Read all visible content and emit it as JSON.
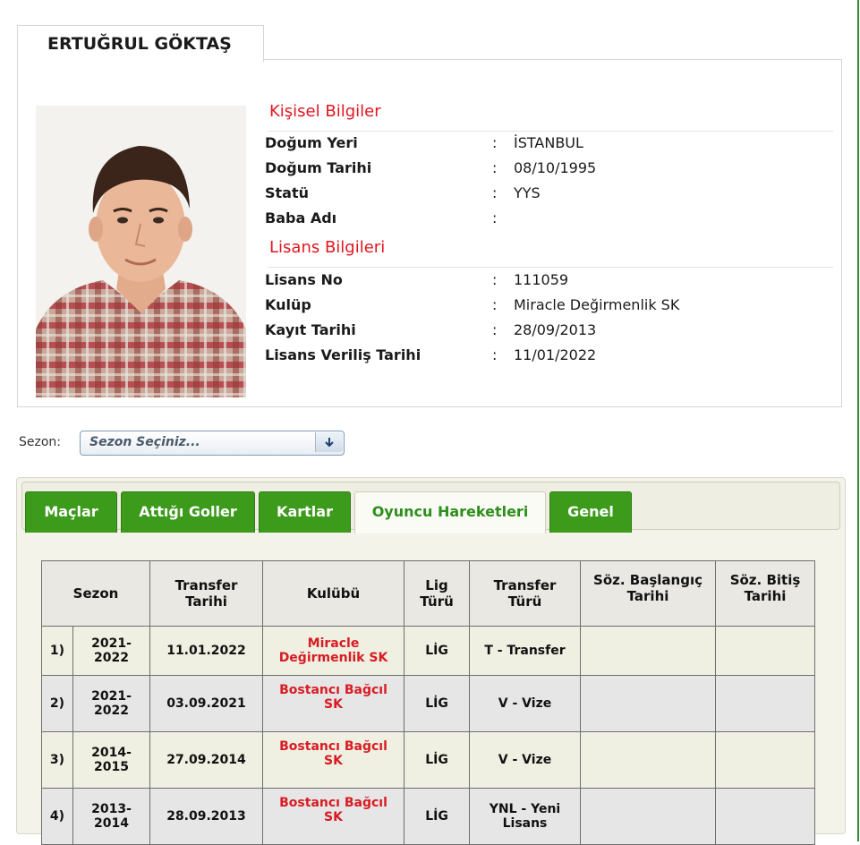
{
  "profile": {
    "name": "ERTUĞRUL GÖKTAŞ",
    "personal_title": "Kişisel Bilgiler",
    "license_title": "Lisans Bilgileri",
    "personal_rows": [
      {
        "label": "Doğum Yeri",
        "value": "İSTANBUL"
      },
      {
        "label": "Doğum Tarihi",
        "value": "08/10/1995"
      },
      {
        "label": "Statü",
        "value": "YYS"
      },
      {
        "label": "Baba Adı",
        "value": ""
      }
    ],
    "license_rows": [
      {
        "label": "Lisans No",
        "value": "111059"
      },
      {
        "label": "Kulüp",
        "value": "Miracle Değirmenlik SK"
      },
      {
        "label": "Kayıt Tarihi",
        "value": "28/09/2013"
      },
      {
        "label": "Lisans Veriliş Tarihi",
        "value": "11/01/2022"
      }
    ],
    "colon": ":"
  },
  "season": {
    "label": "Sezon:",
    "placeholder": "Sezon Seçiniz..."
  },
  "tabs": [
    {
      "label": "Maçlar",
      "active": false
    },
    {
      "label": "Attığı Goller",
      "active": false
    },
    {
      "label": "Kartlar",
      "active": false
    },
    {
      "label": "Oyuncu Hareketleri",
      "active": true
    },
    {
      "label": "Genel",
      "active": false
    }
  ],
  "table": {
    "headers": {
      "sezon": "Sezon",
      "transfer_tarihi_1": "Transfer",
      "transfer_tarihi_2": "Tarihi",
      "kulubu": "Kulübü",
      "lig_1": "Lig",
      "lig_2": "Türü",
      "transfer_turu_1": "Transfer",
      "transfer_turu_2": "Türü",
      "soz_bas_1": "Söz. Başlangıç",
      "soz_bas_2": "Tarihi",
      "soz_bit_1": "Söz. Bitiş",
      "soz_bit_2": "Tarihi"
    },
    "rows": [
      {
        "no": "1)",
        "season_1": "2021-",
        "season_2": "2022",
        "date": "11.01.2022",
        "club_1": "Miracle",
        "club_2": "Değirmenlik SK",
        "league": "LİG",
        "type_1": "T - Transfer",
        "type_2": "",
        "start": "",
        "end": ""
      },
      {
        "no": "2)",
        "season_1": "2021-",
        "season_2": "2022",
        "date": "03.09.2021",
        "club_1": "Bostancı Bağcıl",
        "club_2": "SK",
        "league": "LİG",
        "type_1": "V - Vize",
        "type_2": "",
        "start": "",
        "end": ""
      },
      {
        "no": "3)",
        "season_1": "2014-",
        "season_2": "2015",
        "date": "27.09.2014",
        "club_1": "Bostancı Bağcıl",
        "club_2": "SK",
        "league": "LİG",
        "type_1": "V - Vize",
        "type_2": "",
        "start": "",
        "end": ""
      },
      {
        "no": "4)",
        "season_1": "2013-",
        "season_2": "2014",
        "date": "28.09.2013",
        "club_1": "Bostancı Bağcıl",
        "club_2": "SK",
        "league": "LİG",
        "type_1": "YNL - Yeni",
        "type_2": "Lisans",
        "start": "",
        "end": ""
      }
    ]
  },
  "colors": {
    "accent_red": "#e2161f",
    "tab_green": "#3d9b1c"
  }
}
